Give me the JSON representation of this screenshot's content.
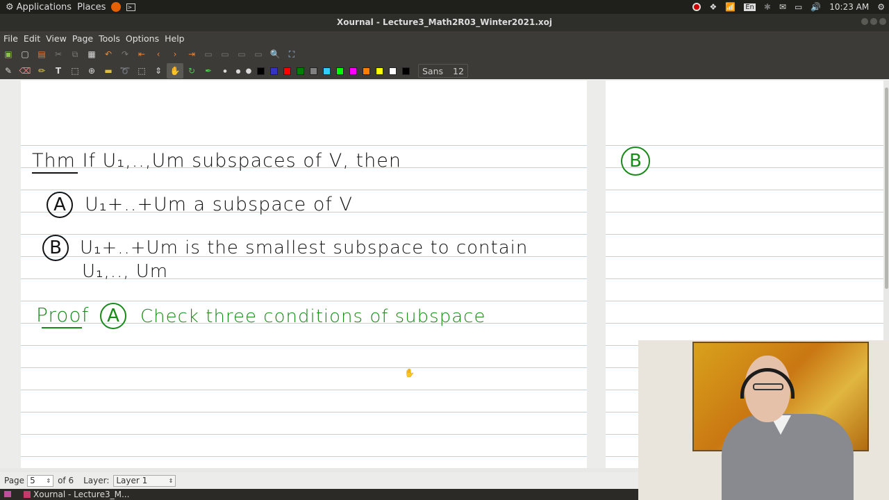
{
  "topbar": {
    "applications": "Applications",
    "places": "Places",
    "lang": "En",
    "time": "10:23 AM"
  },
  "window": {
    "title": "Xournal - Lecture3_Math2R03_Winter2021.xoj"
  },
  "menu": [
    "File",
    "Edit",
    "View",
    "Page",
    "Tools",
    "Options",
    "Help"
  ],
  "toolbar": {
    "font_name": "Sans",
    "font_size": "12",
    "colors": [
      "#000000",
      "#3333cc",
      "#ff0000",
      "#008000",
      "#808080",
      "#33ccff",
      "#00ff00",
      "#ff00ff",
      "#ff8000",
      "#ffff00",
      "#ffffff",
      "#000000"
    ]
  },
  "page1": {
    "theorem": "Thm If U₁,..,Um subspaces of V, then",
    "thm_label": "Thm",
    "part_a_label": "A",
    "part_a": "U₁+..+Um  a subspace of V",
    "part_b_label": "B",
    "part_b_line1": "U₁+..+Um is the smallest subspace to contain",
    "part_b_line2": "U₁,.., Um",
    "proof_label": "Proof",
    "proof_a_label": "A",
    "proof_text": "Check  three conditions of subspace"
  },
  "page2": {
    "b_label": "B"
  },
  "status": {
    "page_label": "Page",
    "page_value": "5",
    "of_pages": "of 6",
    "layer_label": "Layer:",
    "layer_value": "Layer 1"
  },
  "taskbar": {
    "task": "Xournal - Lecture3_M..."
  }
}
